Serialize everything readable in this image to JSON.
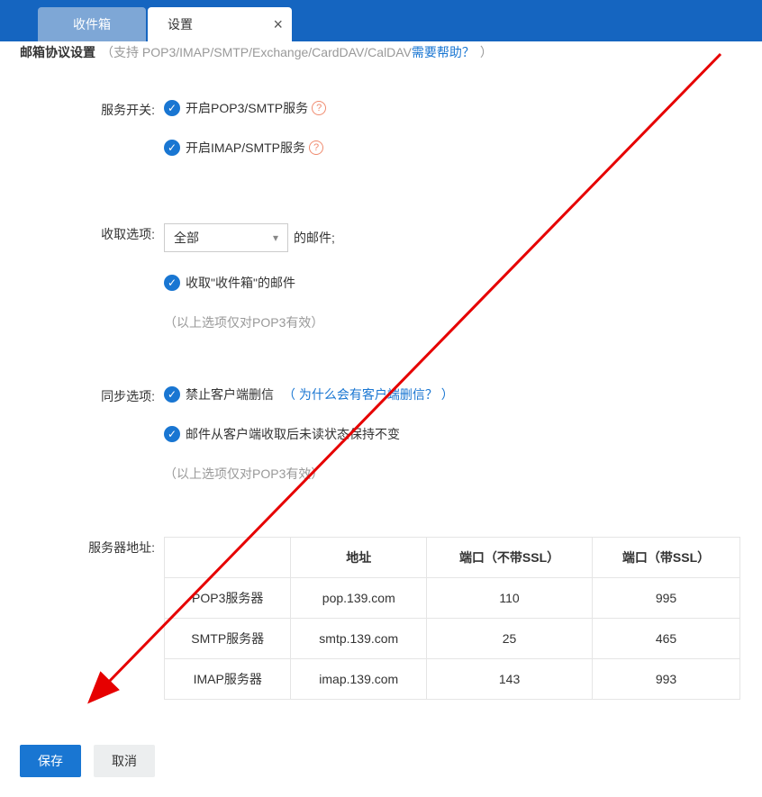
{
  "tabs": {
    "inbox": "收件箱",
    "settings": "设置"
  },
  "header": {
    "title": "邮箱协议设置",
    "subtitle_grey": "（支持 POP3/IMAP/SMTP/Exchange/CardDAV/CalDAV ",
    "subtitle_link": "需要帮助？",
    "subtitle_end": "）"
  },
  "service": {
    "label": "服务开关:",
    "opt1": "开启POP3/SMTP服务",
    "opt2": "开启IMAP/SMTP服务"
  },
  "receive": {
    "label": "收取选项:",
    "dropdown": "全部",
    "after": "的邮件;",
    "opt1": "收取\"收件箱\"的邮件",
    "note": "（以上选项仅对POP3有效）"
  },
  "sync": {
    "label": "同步选项:",
    "opt1": "禁止客户端删信",
    "link_text": "（ 为什么会有客户端删信？ ）",
    "opt2": "邮件从客户端收取后未读状态保持不变",
    "note": "（以上选项仅对POP3有效）"
  },
  "server": {
    "label": "服务器地址:",
    "headers": [
      "",
      "地址",
      "端口（不带SSL）",
      "端口（带SSL）"
    ],
    "rows": [
      {
        "name": "POP3服务器",
        "addr": "pop.139.com",
        "port": "110",
        "ssl": "995"
      },
      {
        "name": "SMTP服务器",
        "addr": "smtp.139.com",
        "port": "25",
        "ssl": "465"
      },
      {
        "name": "IMAP服务器",
        "addr": "imap.139.com",
        "port": "143",
        "ssl": "993"
      }
    ]
  },
  "buttons": {
    "save": "保存",
    "cancel": "取消"
  }
}
